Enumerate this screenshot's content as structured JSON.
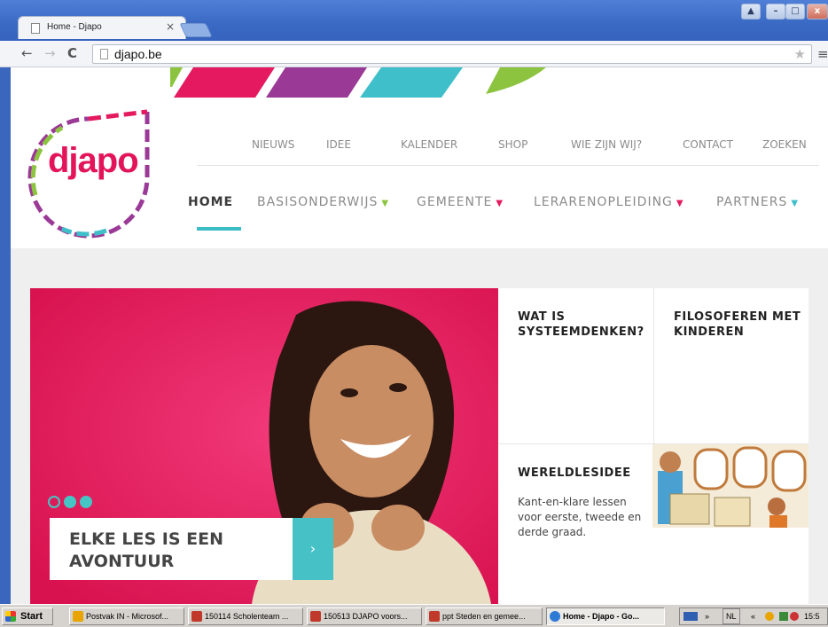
{
  "browser": {
    "tab_title": "Home - Djapo",
    "tab_close": "×",
    "url": "djapo.be",
    "window_buttons": {
      "user": "▲",
      "minimize": "–",
      "maximize": "□",
      "close": "x"
    }
  },
  "site": {
    "logo_text": "djapo",
    "stripe_colors": [
      "#e5195f",
      "#9a3a96",
      "#3fbfca",
      "#8cc43f"
    ],
    "top_nav": [
      "NIEUWS",
      "IDEE",
      "KALENDER",
      "SHOP",
      "WIE ZIJN WIJ?",
      "CONTACT",
      "ZOEKEN"
    ],
    "main_nav": [
      {
        "label": "HOME",
        "active": true,
        "caret_color": ""
      },
      {
        "label": "BASISONDERWIJS",
        "active": false,
        "caret_color": "#8cc43f"
      },
      {
        "label": "GEMEENTE",
        "active": false,
        "caret_color": "#e5195f"
      },
      {
        "label": "LERARENOPLEIDING",
        "active": false,
        "caret_color": "#e5195f"
      },
      {
        "label": "PARTNERS",
        "active": false,
        "caret_color": "#3fbfca"
      }
    ],
    "accent_color": "#3cbcc4"
  },
  "hero": {
    "caption": "ELKE LES IS EEN AVONTUUR",
    "next_icon": "›",
    "slides_total": 3,
    "slide_active": 1
  },
  "tiles": [
    {
      "title": "WAT IS SYSTEEMDENKEN?"
    },
    {
      "title": "FILOSOFEREN MET KINDEREN"
    },
    {
      "title": "WERELDLESIDEE",
      "description": "Kant-en-klare lessen voor eerste, tweede en derde graad."
    }
  ],
  "taskbar": {
    "start_label": "Start",
    "items": [
      {
        "label": "Postvak IN - Microsof...",
        "icon_color": "#e8a400",
        "active": false
      },
      {
        "label": "150114 Scholenteam ...",
        "icon_color": "#c0392b",
        "active": false
      },
      {
        "label": "150513 DJAPO voors...",
        "icon_color": "#c0392b",
        "active": false
      },
      {
        "label": "ppt Steden en gemee...",
        "icon_color": "#c0392b",
        "active": false
      },
      {
        "label": "Home - Djapo - Go...",
        "icon_color": "#2e7bd6",
        "active": true
      }
    ],
    "tray": {
      "language": "NL",
      "chevrons": "»",
      "back_chevrons": "«",
      "clock": "15:5"
    }
  }
}
